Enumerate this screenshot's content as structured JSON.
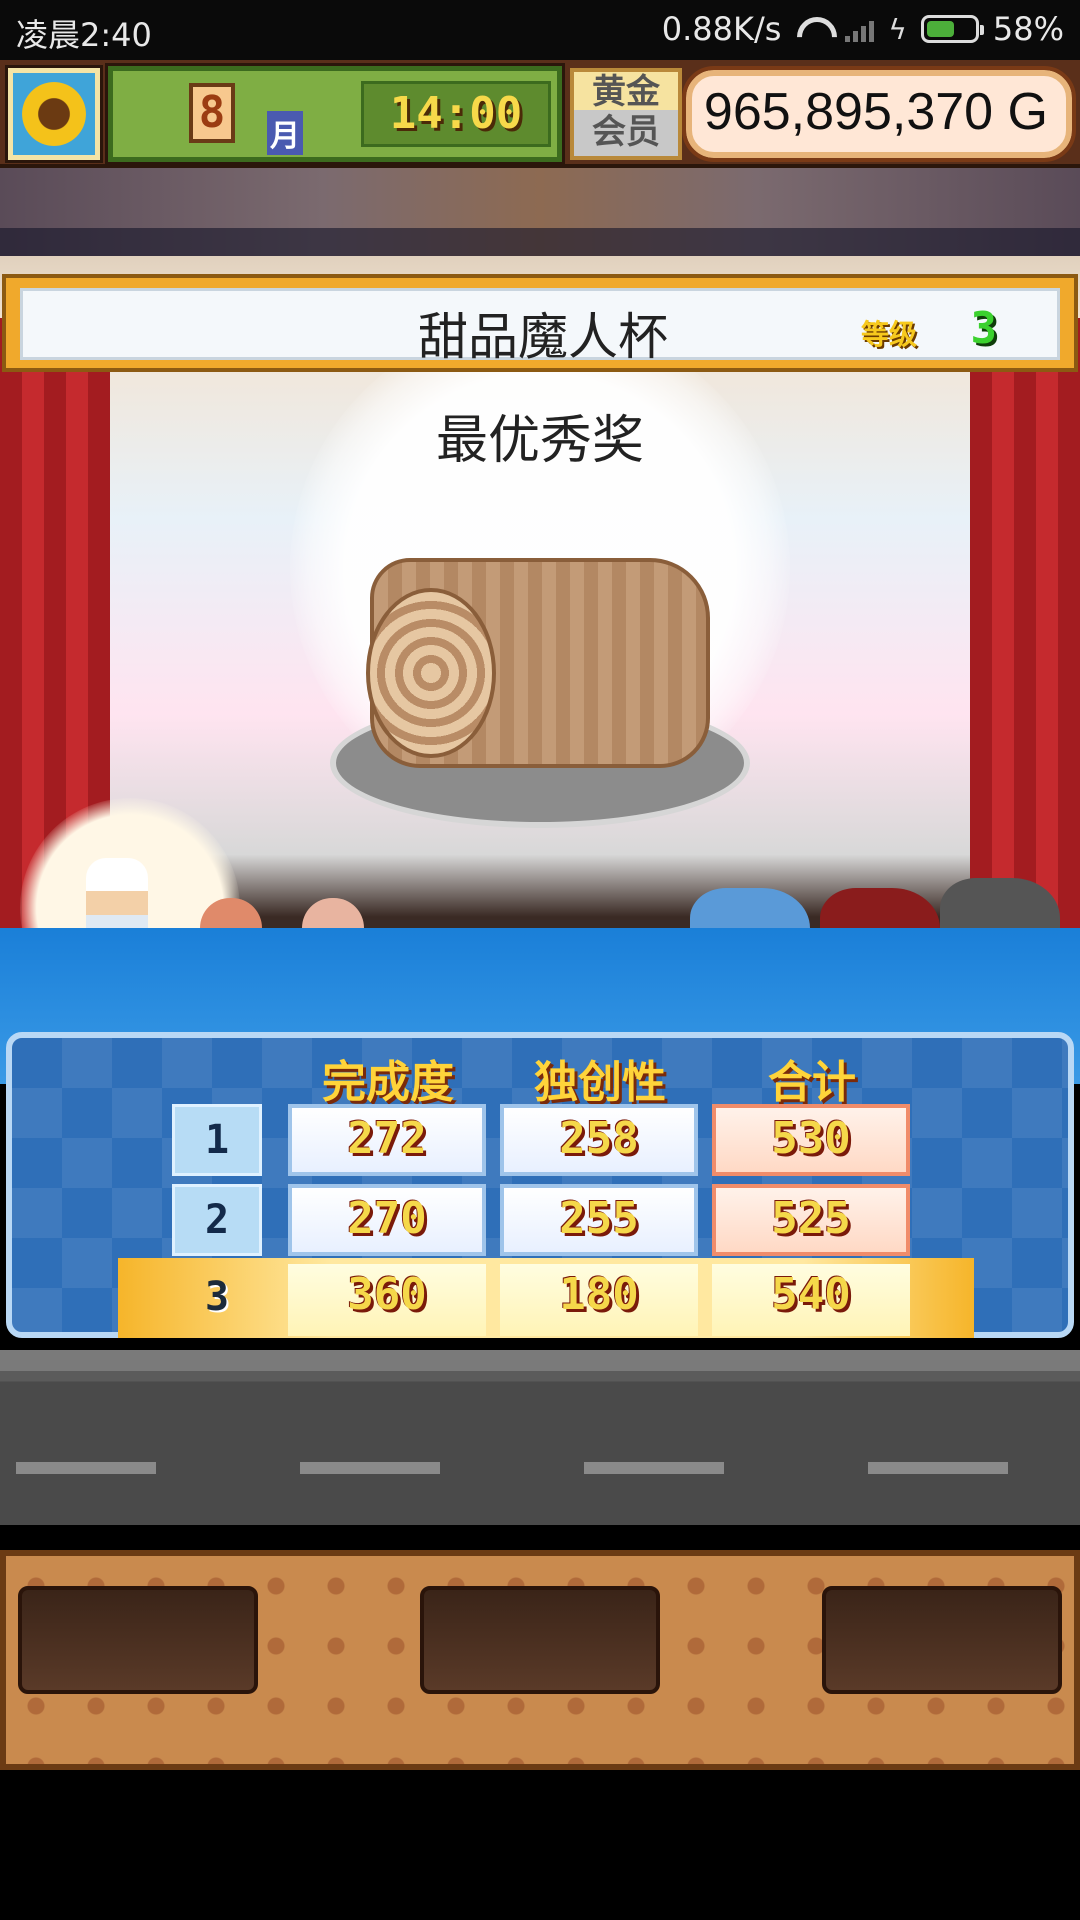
{
  "status_bar": {
    "time": "凌晨2:40",
    "network_speed": "0.88K/s",
    "battery_percent": "58%",
    "battery_level": 0.58,
    "icons": [
      "wifi-icon",
      "signal-icon",
      "charging-icon",
      "battery-icon"
    ]
  },
  "hud": {
    "month": "8",
    "month_label": "月",
    "time": "14:00",
    "member_badge": "黄金\n会员",
    "gold": "965,895,370 G"
  },
  "stage": {
    "contest_title": "甜品魔人杯",
    "grade_label": "等级",
    "grade_value": "3",
    "award": "最优秀奖"
  },
  "scores": {
    "headers": [
      "完成度",
      "独创性",
      "合计"
    ],
    "rows": [
      {
        "rank": "1",
        "completion": "272",
        "originality": "258",
        "total": "530"
      },
      {
        "rank": "2",
        "completion": "270",
        "originality": "255",
        "total": "525"
      },
      {
        "rank": "3",
        "completion": "360",
        "originality": "180",
        "total": "540"
      }
    ]
  },
  "colors": {
    "accent_gold": "#f0a92c",
    "panel_blue": "#2f6fb8",
    "score_text": "#f5d84a"
  }
}
